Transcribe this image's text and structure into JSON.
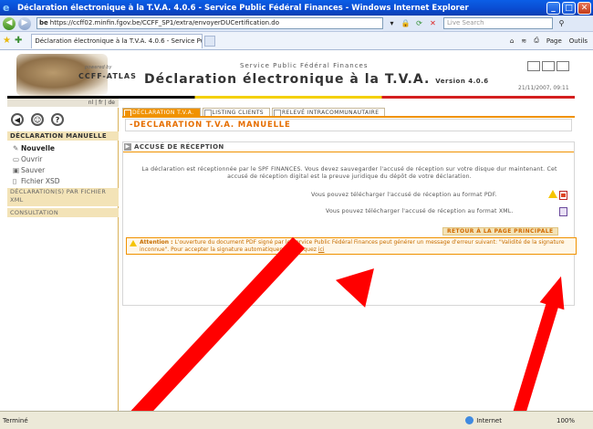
{
  "window": {
    "title": "Déclaration électronique à la T.V.A. 4.0.6 - Service Public Fédéral Finances - Windows Internet Explorer",
    "minimize": "_",
    "maximize": "□",
    "close": "✕"
  },
  "address": {
    "domain_badge": "be",
    "url": "https://ccff02.minfin.fgov.be/CCFF_SP1/extra/envoyerDUCertification.do",
    "search_placeholder": "Live Search"
  },
  "tabbar": {
    "tab_title": "Déclaration électronique à la T.V.A. 4.0.6 - Service Pu...",
    "page_label": "Page",
    "tools_label": "Outils"
  },
  "banner": {
    "powered_by": "powered by",
    "logo": "CCFF-ATLAS",
    "service": "Service Public Fédéral Finances",
    "app_title": "Déclaration électronique à la T.V.A.",
    "version": "Version 4.0.6",
    "date": "21/11/2007, 09:11",
    "lang": "nl | fr | de"
  },
  "sidebar": {
    "heading": "DÉCLARATION MANUELLE",
    "items": [
      {
        "label": "Nouvelle",
        "icon": "pencil-icon"
      },
      {
        "label": "Ouvrir",
        "icon": "folder-icon"
      },
      {
        "label": "Sauver",
        "icon": "save-icon"
      },
      {
        "label": "Fichier XSD",
        "icon": "file-icon"
      }
    ],
    "cat_xml": "DÉCLARATION(S) PAR FICHIER XML",
    "cat_consult": "CONSULTATION"
  },
  "tabs": [
    {
      "label": "DÉCLARATION T.V.A."
    },
    {
      "label": "LISTING CLIENTS"
    },
    {
      "label": "RELEVÉ INTRACOMMUNAUTAIRE"
    }
  ],
  "main": {
    "manual_header": "-DECLARATION T.V.A. MANUELLE",
    "section_title": "ACCUSÉ DE RÉCEPTION",
    "message": "La déclaration est réceptionnée par le SPF FINANCES. Vous devez sauvegarder l'accusé de réception sur votre disque dur maintenant. Cet accusé de réception digital est la preuve juridique du dépôt de votre déclaration.",
    "download_pdf": "Vous pouvez télécharger l'accusé de réception au format PDF.",
    "download_xml": "Vous pouvez télécharger l'accusé de réception au format XML.",
    "retour": "RETOUR À LA PAGE PRINCIPALE",
    "attention_label": "Attention :",
    "attention_text": "L'ouverture du document PDF signé par le Service Public Fédéral Finances peut générer un message d'erreur suivant: \"Validité de la signature inconnue\". Pour accepter la signature automatiquement, cliquez",
    "attention_link": "ici"
  },
  "status": {
    "left": "Terminé",
    "zone": "Internet",
    "zoom": "100%"
  },
  "colors": {
    "accent": "#f09200",
    "arrow": "#ff0000"
  }
}
